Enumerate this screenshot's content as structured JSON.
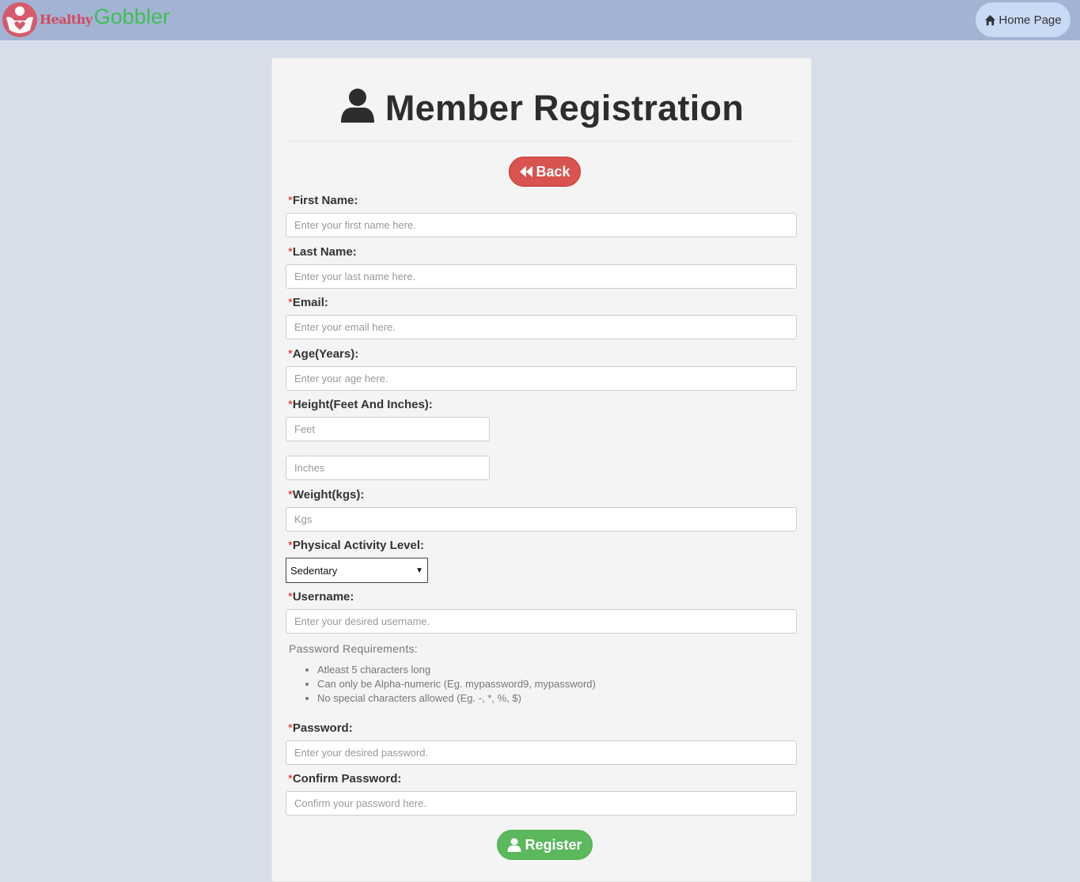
{
  "header": {
    "logo_healthy": "Healthy",
    "logo_gobbler": "Gobbler",
    "home_label": "Home Page"
  },
  "form": {
    "title": "Member Registration",
    "back_label": "Back",
    "required_mark": "*",
    "fields": {
      "first_name": {
        "label": "First Name:",
        "placeholder": "Enter your first name here."
      },
      "last_name": {
        "label": "Last Name:",
        "placeholder": "Enter your last name here."
      },
      "email": {
        "label": "Email:",
        "placeholder": "Enter your email here."
      },
      "age": {
        "label": "Age(Years):",
        "placeholder": "Enter your age here."
      },
      "height": {
        "label": "Height(Feet And Inches):",
        "feet_placeholder": "Feet",
        "inches_placeholder": "Inches"
      },
      "weight": {
        "label": "Weight(kgs):",
        "placeholder": "Kgs"
      },
      "activity": {
        "label": "Physical Activity Level:",
        "selected": "Sedentary"
      },
      "username": {
        "label": "Username:",
        "placeholder": "Enter your desired username."
      },
      "password": {
        "label": "Password:",
        "placeholder": "Enter your desired password."
      },
      "confirm_password": {
        "label": "Confirm Password:",
        "placeholder": "Confirm your password here."
      }
    },
    "password_requirements": {
      "title": "Password Requirements:",
      "items": [
        "Atleast 5 characters long",
        "Can only be Alpha-numeric (Eg. mypassword9, mypassword)",
        "No special characters allowed (Eg. -, *, %, $)"
      ]
    },
    "register_label": "Register"
  },
  "colors": {
    "topbar": "#a3b3d3",
    "page_bg": "#d7deea",
    "back_button": "#d9534f",
    "register_button": "#5cb85c",
    "required_mark": "#e0262b"
  },
  "icons": {
    "logo": "heart-person-logo-icon",
    "home": "home-icon",
    "title": "user-icon",
    "back": "fast-backward-icon",
    "register": "user-icon",
    "select": "caret-down-icon"
  }
}
